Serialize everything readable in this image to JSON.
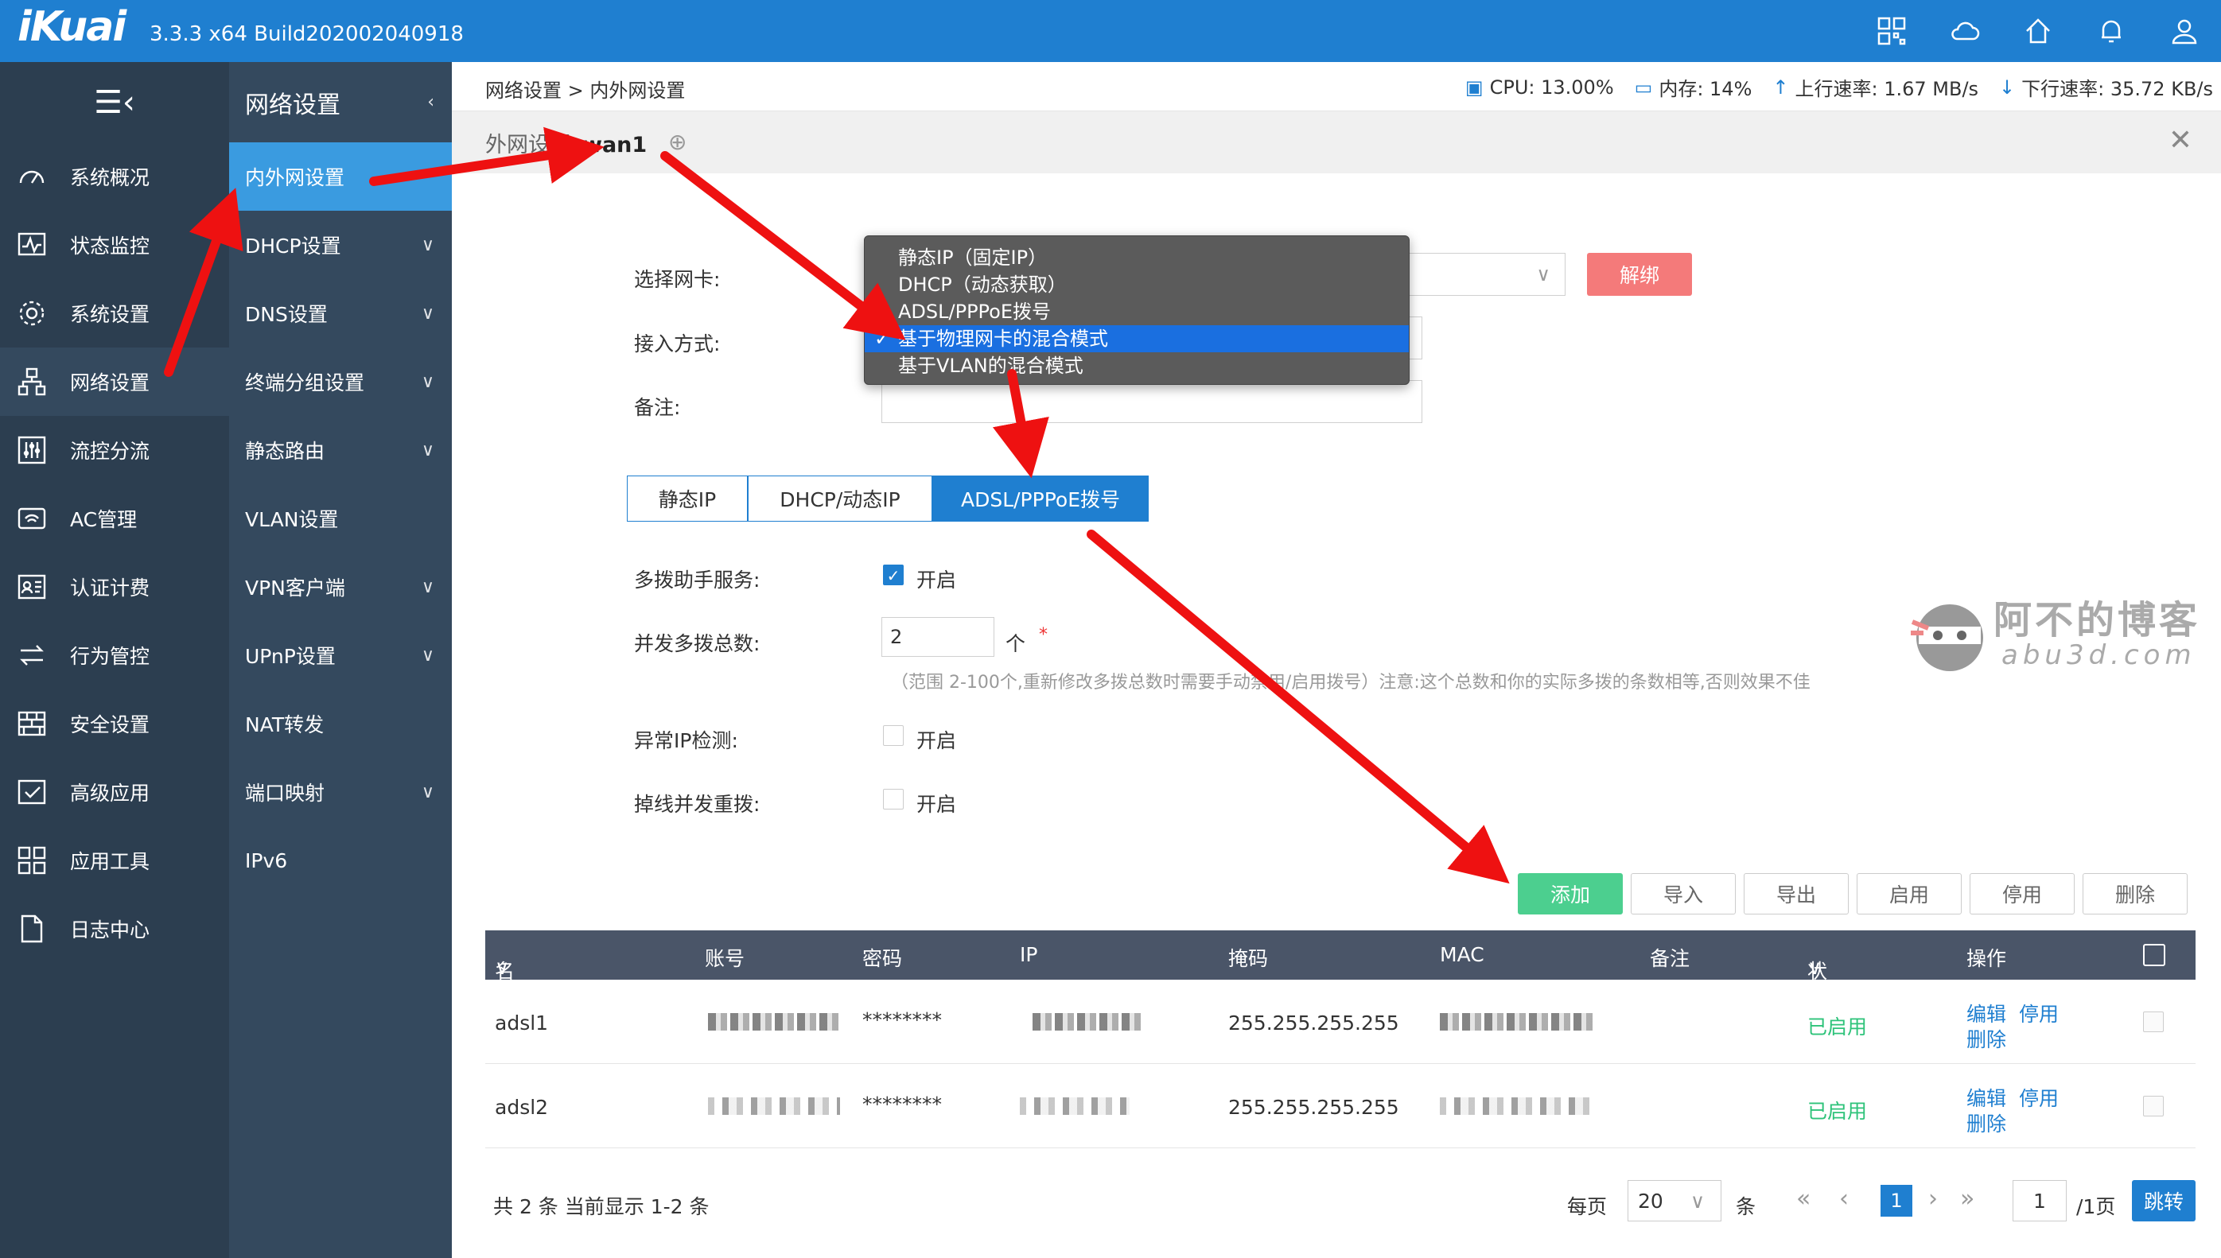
{
  "app": {
    "logo": "iKuai",
    "version": "3.3.3 x64 Build202002040918",
    "top_icons": [
      "grid-icon",
      "cloud-icon",
      "home-icon",
      "bell-icon",
      "user-icon"
    ]
  },
  "sidebar": {
    "toggle": "☰‹",
    "items": [
      {
        "label": "系统概况",
        "icon": "dashboard-icon"
      },
      {
        "label": "状态监控",
        "icon": "monitor-icon"
      },
      {
        "label": "系统设置",
        "icon": "gear-icon"
      },
      {
        "label": "网络设置",
        "icon": "network-icon",
        "active": true
      },
      {
        "label": "流控分流",
        "icon": "sliders-icon"
      },
      {
        "label": "AC管理",
        "icon": "wifi-icon"
      },
      {
        "label": "认证计费",
        "icon": "id-card-icon"
      },
      {
        "label": "行为管控",
        "icon": "arrows-icon"
      },
      {
        "label": "安全设置",
        "icon": "firewall-icon"
      },
      {
        "label": "高级应用",
        "icon": "check-box-icon"
      },
      {
        "label": "应用工具",
        "icon": "apps-icon"
      },
      {
        "label": "日志中心",
        "icon": "document-icon"
      }
    ]
  },
  "submenu": {
    "title": "网络设置",
    "items": [
      {
        "label": "内外网设置",
        "active": true,
        "chevron": false
      },
      {
        "label": "DHCP设置",
        "chevron": true
      },
      {
        "label": "DNS设置",
        "chevron": true
      },
      {
        "label": "终端分组设置",
        "chevron": true
      },
      {
        "label": "静态路由",
        "chevron": true
      },
      {
        "label": "VLAN设置",
        "chevron": false
      },
      {
        "label": "VPN客户端",
        "chevron": true
      },
      {
        "label": "UPnP设置",
        "chevron": true
      },
      {
        "label": "NAT转发",
        "chevron": false
      },
      {
        "label": "端口映射",
        "chevron": true
      },
      {
        "label": "IPv6",
        "chevron": false
      }
    ]
  },
  "header": {
    "breadcrumb": "网络设置 > 内外网设置",
    "cpu": "CPU: 13.00%",
    "memory": "内存: 14%",
    "upload": "上行速率: 1.67 MB/s",
    "download": "下行速率: 35.72 KB/s"
  },
  "panel": {
    "title": "外网设置",
    "wan": "wan1",
    "plus": "⊕",
    "close": "✕"
  },
  "form": {
    "nic_label": "选择网卡:",
    "unbind": "解绑",
    "access_label": "接入方式:",
    "note_label": "备注:",
    "access_options": [
      "静态IP（固定IP）",
      "DHCP（动态获取）",
      "ADSL/PPPoE拨号",
      "基于物理网卡的混合模式",
      "基于VLAN的混合模式"
    ],
    "access_selected": "基于物理网卡的混合模式",
    "tabs": [
      "静态IP",
      "DHCP/动态IP",
      "ADSL/PPPoE拨号"
    ],
    "active_tab": "ADSL/PPPoE拨号",
    "multi_dial_label": "多拨助手服务:",
    "multi_dial_value": "开启",
    "concurrent_label": "并发多拨总数:",
    "concurrent_value": "2",
    "concurrent_unit": "个",
    "required_mark": "*",
    "hint": "（范围 2-100个,重新修改多拨总数时需要手动禁用/启用拨号）注意:这个总数和你的实际多拨的条数相等,否则效果不佳",
    "abnormal_ip_label": "异常IP检测:",
    "abnormal_ip_value": "开启",
    "redial_label": "掉线并发重拨:",
    "redial_value": "开启"
  },
  "actions": [
    "添加",
    "导入",
    "导出",
    "启用",
    "停用",
    "删除"
  ],
  "table": {
    "headers": [
      "名称",
      "账号",
      "密码",
      "IP",
      "掩码",
      "MAC",
      "备注",
      "状态",
      "操作"
    ],
    "rows": [
      {
        "name": "adsl1",
        "password": "********",
        "mask": "255.255.255.255",
        "status": "已启用",
        "edit": "编辑",
        "disable": "停用",
        "delete": "删除"
      },
      {
        "name": "adsl2",
        "password": "********",
        "mask": "255.255.255.255",
        "status": "已启用",
        "edit": "编辑",
        "disable": "停用",
        "delete": "删除"
      }
    ]
  },
  "pagination": {
    "summary": "共 2 条 当前显示 1-2 条",
    "per_page_label": "每页",
    "per_page": "20",
    "per_page_unit": "条",
    "current": "1",
    "page_input": "1",
    "total_pages": "/1页",
    "jump": "跳转"
  },
  "watermark": {
    "title": "阿不的博客",
    "domain": "abu3d.com"
  },
  "colors": {
    "brand": "#1f7fd0",
    "sidebar": "#2c3e50",
    "submenu": "#34495e",
    "submenu_active": "#3a9be0",
    "add_button": "#4ccf8f",
    "unbind_button": "#f47a7a",
    "status_green": "#2ec37a",
    "annotation_arrow": "#ee1111"
  }
}
